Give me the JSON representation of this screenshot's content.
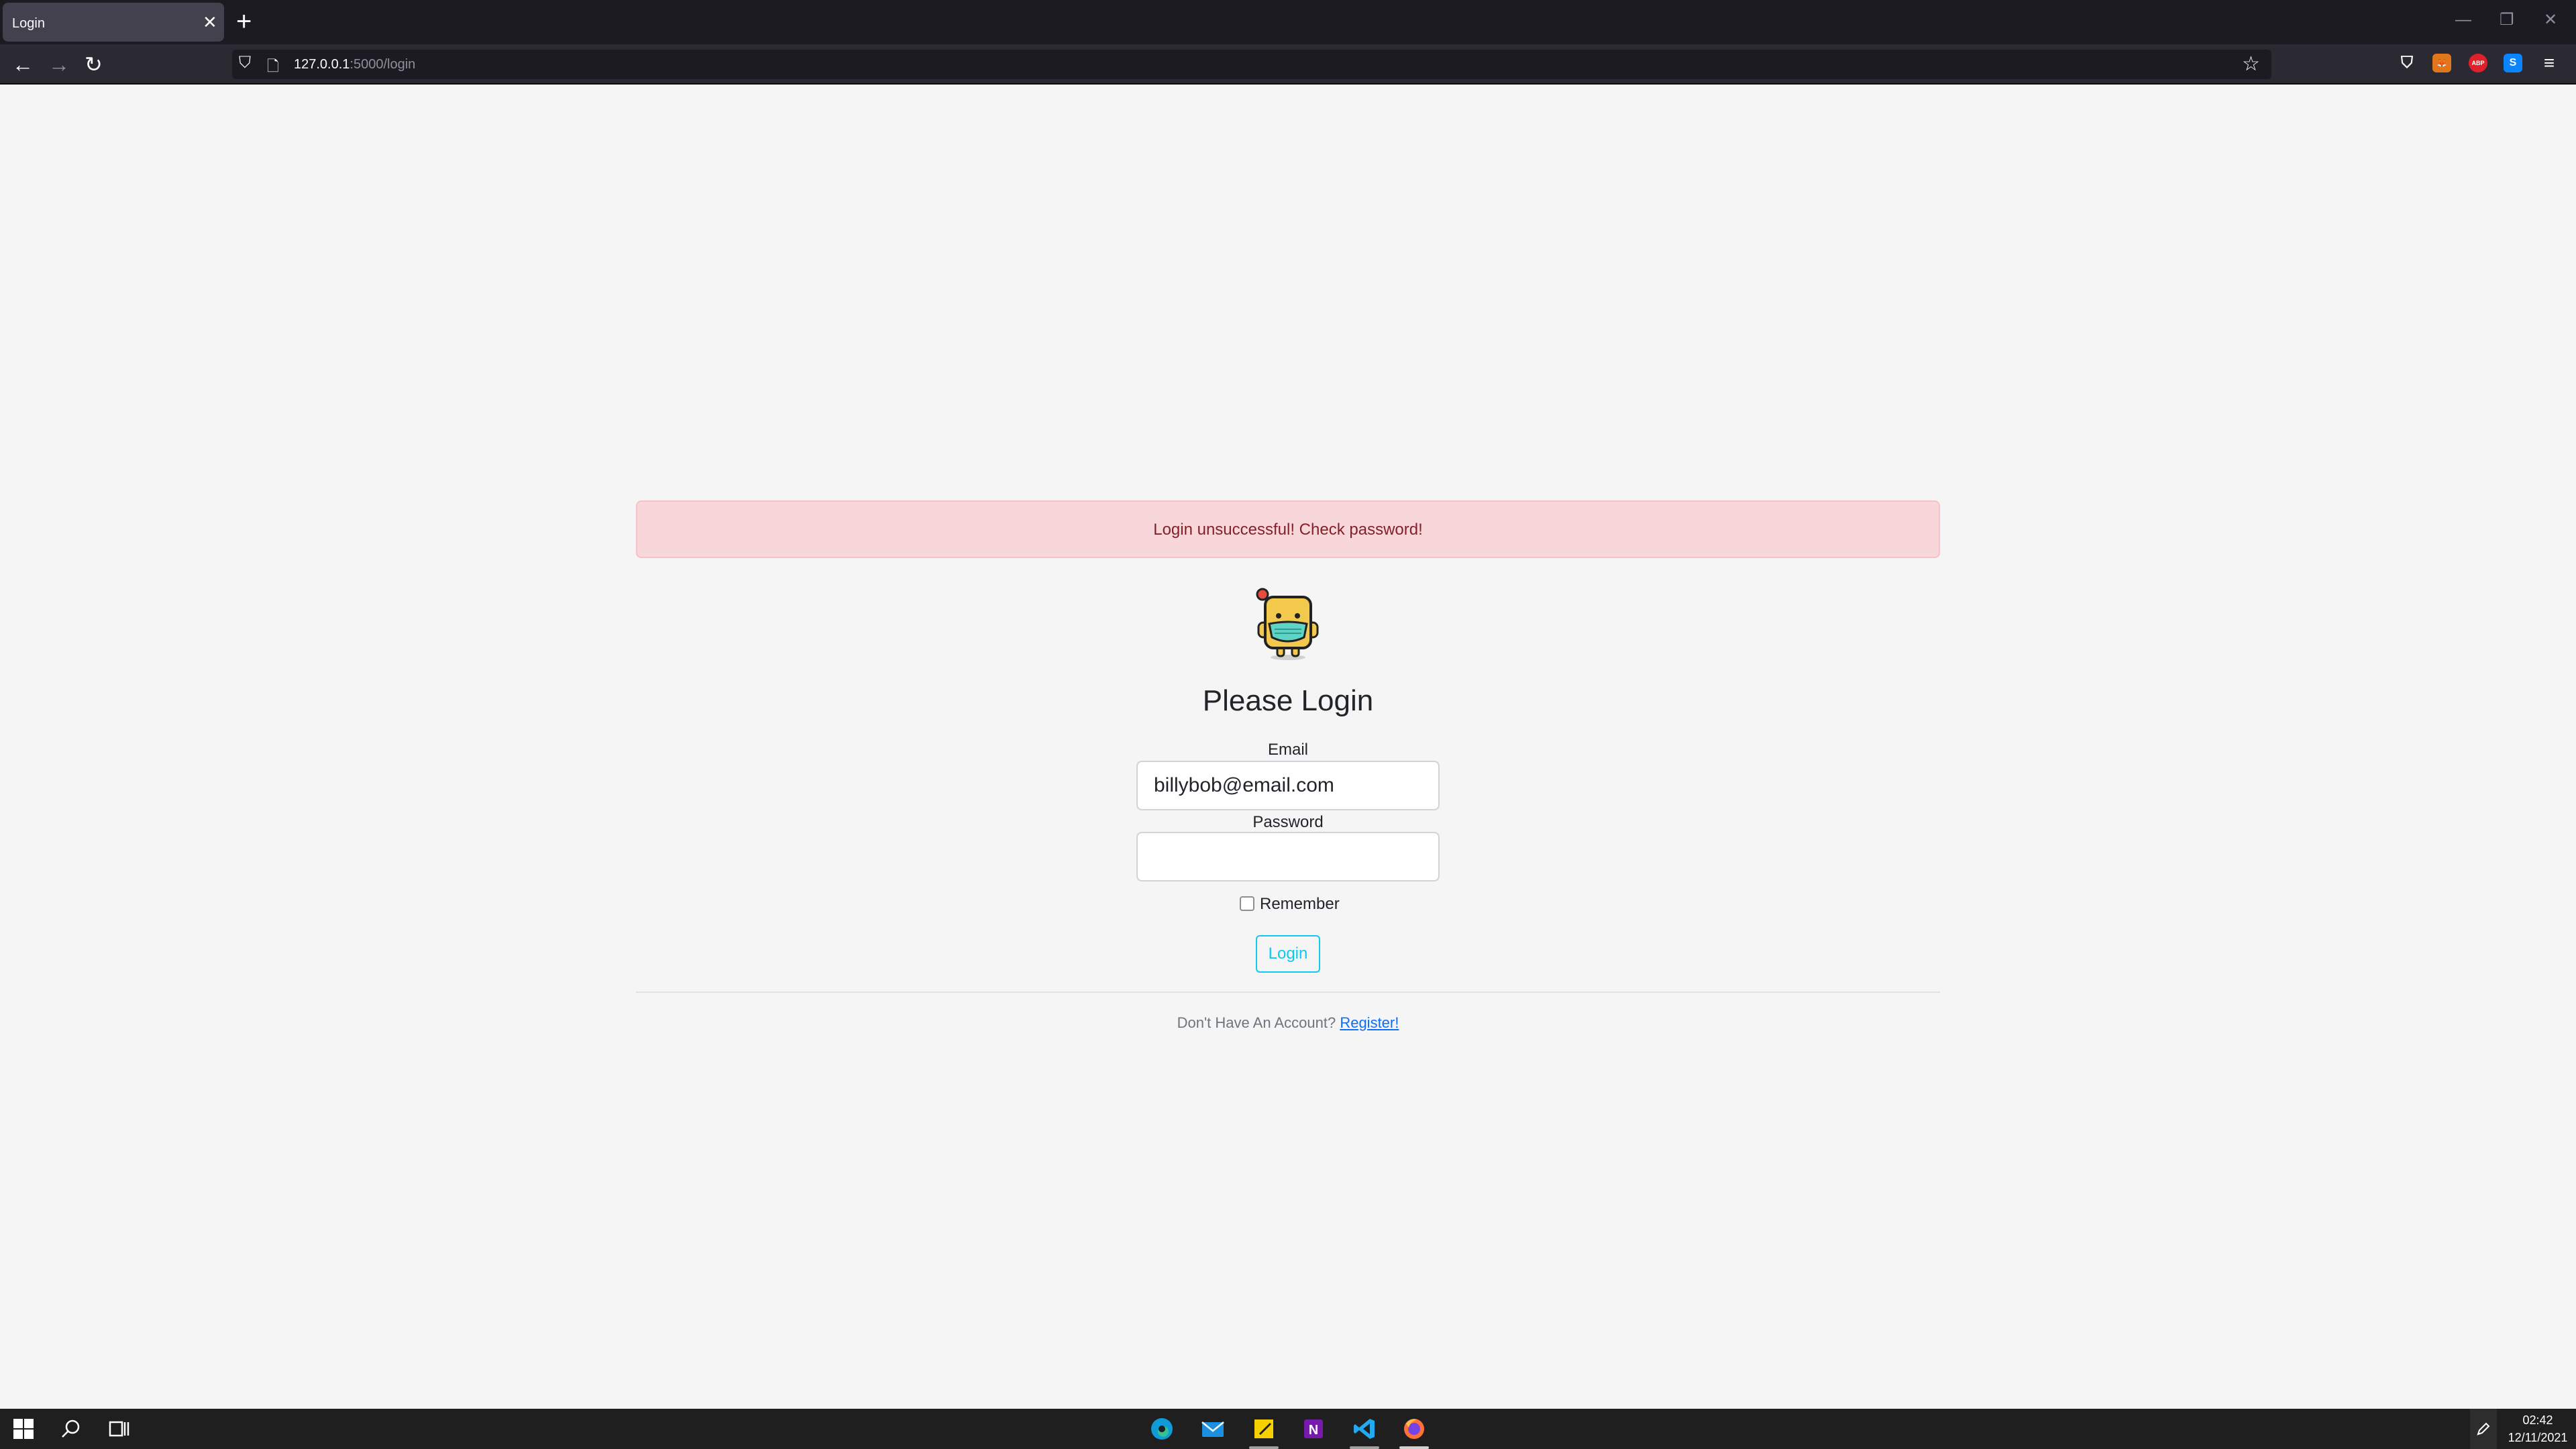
{
  "browser": {
    "tab_title": "Login",
    "tab_close": "✕",
    "new_tab": "+",
    "window_controls": [
      "—",
      "❐",
      "✕"
    ],
    "url_host": "127.0.0.1",
    "url_path": ":5000/login",
    "icons": [
      "back-icon",
      "forward-icon",
      "reload-icon",
      "shield-icon",
      "page-icon",
      "star-icon",
      "pocket-icon",
      "metamask-icon",
      "adblock-icon",
      "s-extension-icon",
      "menu-icon"
    ]
  },
  "alert": {
    "text": "Login unsuccessful! Check password!",
    "color": "#842029",
    "background": "#f8d7da"
  },
  "form": {
    "title": "Please Login",
    "email_label": "Email",
    "email_value": "billybob@email.com",
    "password_label": "Password",
    "password_value": "",
    "remember_label": "Remember",
    "remember_checked": false,
    "login_button": "Login",
    "accent": "#0dcaf0"
  },
  "footer": {
    "prompt": "Don't Have An Account?",
    "link": "Register!"
  },
  "taskbar": {
    "apps": [
      "edge-icon",
      "mail-icon",
      "sticky-notes-icon",
      "onenote-icon",
      "vscode-icon",
      "firefox-icon"
    ],
    "time": "02:42",
    "date": "12/11/2021"
  }
}
